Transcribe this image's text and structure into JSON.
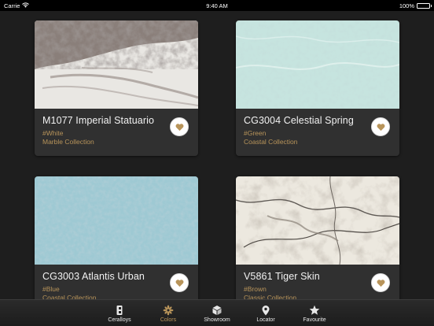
{
  "status_bar": {
    "carrier": "Carrie",
    "time": "9:40 AM",
    "battery": "100%"
  },
  "cards": [
    {
      "title": "M1077 Imperial Statuario",
      "tag": "#White",
      "collection": "Marble Collection",
      "swatch_icon": "imperial-statuario-stone-texture"
    },
    {
      "title": "CG3004 Celestial Spring",
      "tag": "#Green",
      "collection": "Coastal Collection",
      "swatch_icon": "celestial-spring-stone-texture"
    },
    {
      "title": "CG3003 Atlantis Urban",
      "tag": "#Blue",
      "collection": "Coastal Collection",
      "swatch_icon": "atlantis-urban-stone-texture"
    },
    {
      "title": "V5861 Tiger Skin",
      "tag": "#Brown",
      "collection": "Classic Collection",
      "swatch_icon": "tiger-skin-stone-texture"
    }
  ],
  "tabs": [
    {
      "label": "Ceralloys",
      "icon": "ceralloys-logo-icon",
      "active": false
    },
    {
      "label": "Colors",
      "icon": "flower-icon",
      "active": true
    },
    {
      "label": "Showroom",
      "icon": "cube-icon",
      "active": false
    },
    {
      "label": "Locator",
      "icon": "map-pin-icon",
      "active": false
    },
    {
      "label": "Favourite",
      "icon": "star-icon",
      "active": false
    }
  ],
  "colors": {
    "background": "#1e1e1e",
    "card": "#303030",
    "accent": "#b8945a",
    "heart": "#b8945a"
  }
}
